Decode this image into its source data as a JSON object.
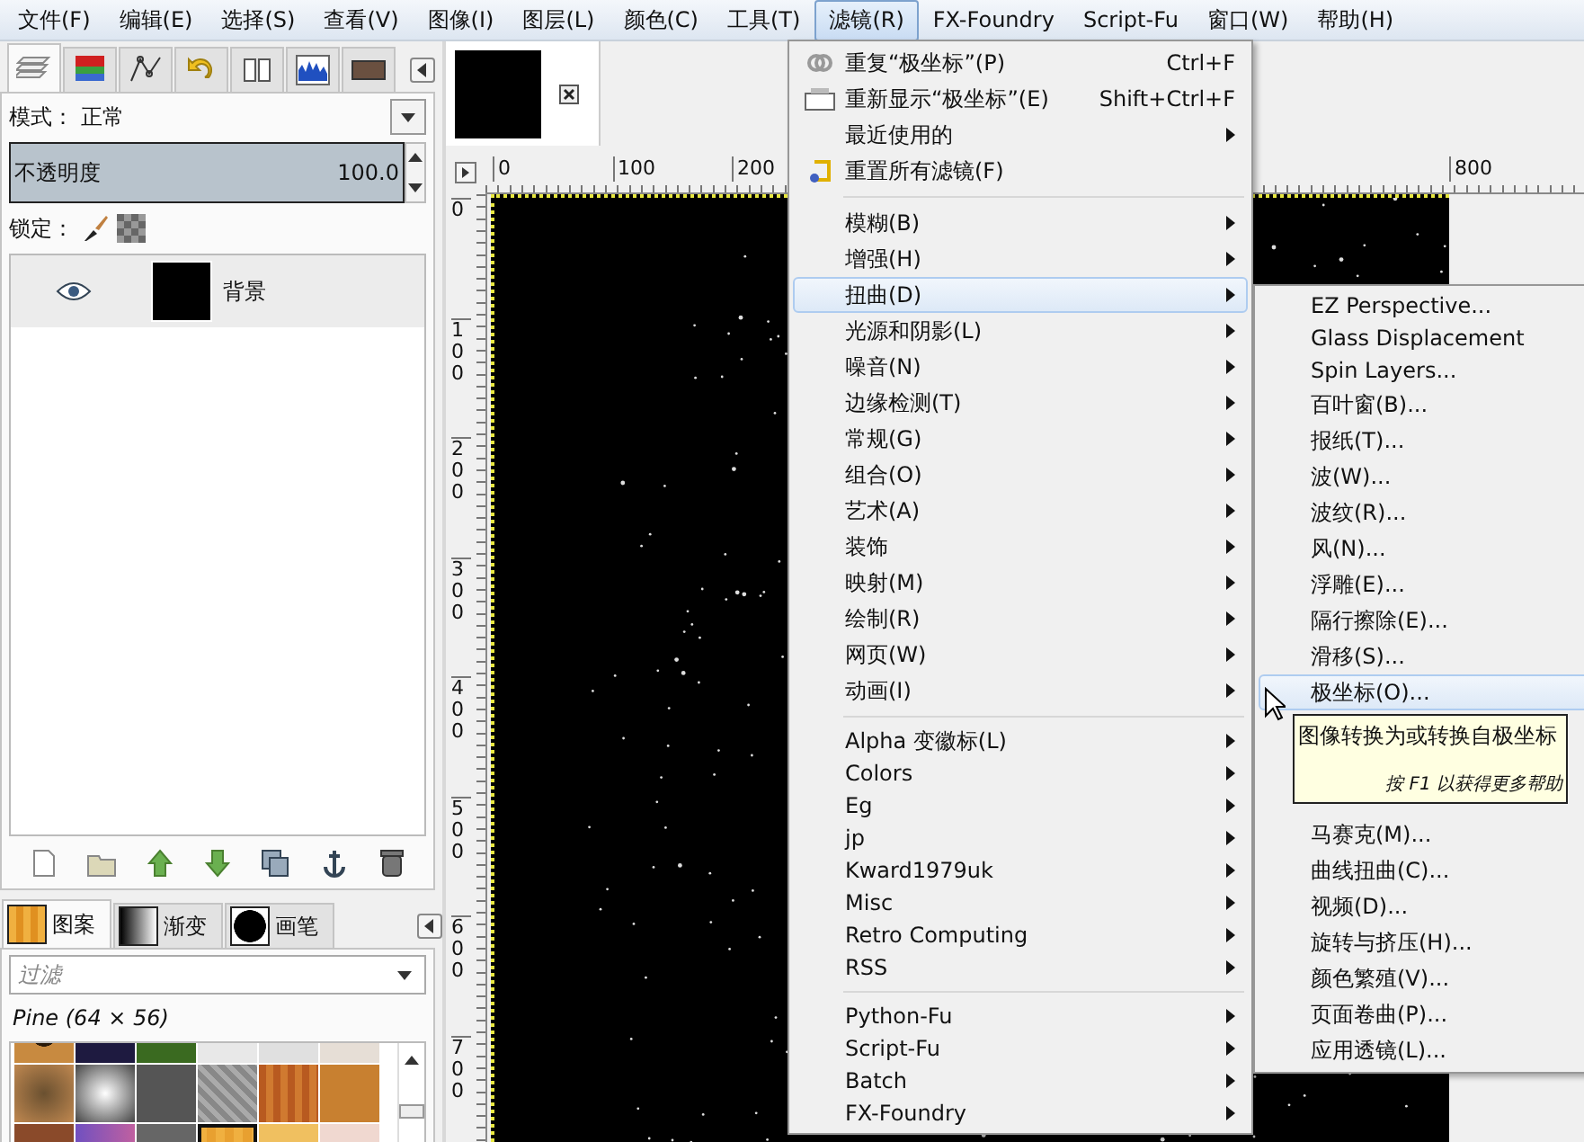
{
  "menubar": [
    {
      "label": "文件(F)",
      "selected": false
    },
    {
      "label": "编辑(E)",
      "selected": false
    },
    {
      "label": "选择(S)",
      "selected": false
    },
    {
      "label": "查看(V)",
      "selected": false
    },
    {
      "label": "图像(I)",
      "selected": false
    },
    {
      "label": "图层(L)",
      "selected": false
    },
    {
      "label": "颜色(C)",
      "selected": false
    },
    {
      "label": "工具(T)",
      "selected": false
    },
    {
      "label": "滤镜(R)",
      "selected": true
    },
    {
      "label": "FX-Foundry",
      "selected": false
    },
    {
      "label": "Script-Fu",
      "selected": false
    },
    {
      "label": "窗口(W)",
      "selected": false
    },
    {
      "label": "帮助(H)",
      "selected": false
    }
  ],
  "left_panel": {
    "dock_tabs": [
      {
        "selected": true
      },
      {
        "selected": false
      },
      {
        "selected": false
      },
      {
        "selected": false
      },
      {
        "selected": false
      },
      {
        "selected": false
      },
      {
        "selected": false
      }
    ],
    "mode": {
      "label": "模式：",
      "value": "正常"
    },
    "opacity": {
      "label": "不透明度",
      "reading": "100.0",
      "level": 1
    },
    "lock": {
      "label": "锁定："
    },
    "layers": [
      {
        "name": "背景",
        "visible": true
      }
    ],
    "resource_tabs": [
      {
        "label": "图案",
        "selected": true
      },
      {
        "label": "渐变",
        "selected": false
      },
      {
        "label": "画笔",
        "selected": false
      }
    ],
    "filter": {
      "placeholder": "过滤"
    },
    "pattern_name": "Pine (64 × 56)",
    "patterns": [
      {
        "selected": false
      },
      {
        "selected": false
      },
      {
        "selected": false
      },
      {
        "selected": false
      },
      {
        "selected": false
      },
      {
        "selected": false
      },
      {
        "selected": false
      },
      {
        "selected": false
      },
      {
        "selected": false
      },
      {
        "selected": false
      },
      {
        "selected": false
      },
      {
        "selected": false
      },
      {
        "selected": false
      },
      {
        "selected": false
      },
      {
        "selected": false
      },
      {
        "selected": true
      },
      {
        "selected": false
      },
      {
        "selected": false
      }
    ]
  },
  "canvas": {
    "h_ruler": [
      "0",
      "100",
      "200",
      "800"
    ],
    "v_ruler": [
      "0",
      "100",
      "200",
      "300",
      "400",
      "500",
      "600",
      "700"
    ]
  },
  "filters_menu": {
    "sections": [
      {
        "items": [
          {
            "label": "重复“极坐标”(P)",
            "shortcut": "Ctrl+F",
            "submenu": false,
            "selected": false
          },
          {
            "label": "重新显示“极坐标”(E)",
            "shortcut": "Shift+Ctrl+F",
            "submenu": false,
            "selected": false
          },
          {
            "label": "最近使用的",
            "submenu": true,
            "selected": false
          },
          {
            "label": "重置所有滤镜(F)",
            "submenu": false,
            "selected": false
          }
        ]
      },
      {
        "items": [
          {
            "label": "模糊(B)",
            "submenu": true,
            "selected": false
          },
          {
            "label": "增强(H)",
            "submenu": true,
            "selected": false
          },
          {
            "label": "扭曲(D)",
            "submenu": true,
            "selected": true
          },
          {
            "label": "光源和阴影(L)",
            "submenu": true,
            "selected": false
          },
          {
            "label": "噪音(N)",
            "submenu": true,
            "selected": false
          },
          {
            "label": "边缘检测(T)",
            "submenu": true,
            "selected": false
          },
          {
            "label": "常规(G)",
            "submenu": true,
            "selected": false
          },
          {
            "label": "组合(O)",
            "submenu": true,
            "selected": false
          },
          {
            "label": "艺术(A)",
            "submenu": true,
            "selected": false
          },
          {
            "label": "装饰",
            "submenu": true,
            "selected": false
          },
          {
            "label": "映射(M)",
            "submenu": true,
            "selected": false
          },
          {
            "label": "绘制(R)",
            "submenu": true,
            "selected": false
          },
          {
            "label": "网页(W)",
            "submenu": true,
            "selected": false
          },
          {
            "label": "动画(I)",
            "submenu": true,
            "selected": false
          }
        ]
      },
      {
        "items": [
          {
            "label": "Alpha 变徽标(L)",
            "submenu": true,
            "selected": false
          },
          {
            "label": "Colors",
            "submenu": true,
            "selected": false
          },
          {
            "label": "Eg",
            "submenu": true,
            "selected": false
          },
          {
            "label": "jp",
            "submenu": true,
            "selected": false
          },
          {
            "label": "Kward1979uk",
            "submenu": true,
            "selected": false
          },
          {
            "label": "Misc",
            "submenu": true,
            "selected": false
          },
          {
            "label": "Retro Computing",
            "submenu": true,
            "selected": false
          },
          {
            "label": "RSS",
            "submenu": true,
            "selected": false
          }
        ]
      },
      {
        "items": [
          {
            "label": "Python-Fu",
            "submenu": true,
            "selected": false
          },
          {
            "label": "Script-Fu",
            "submenu": true,
            "selected": false
          },
          {
            "label": "Batch",
            "submenu": true,
            "selected": false
          },
          {
            "label": "FX-Foundry",
            "submenu": true,
            "selected": false
          }
        ]
      }
    ]
  },
  "distort_submenu": {
    "items": [
      {
        "label": "EZ Perspective...",
        "selected": false
      },
      {
        "label": "Glass Displacement",
        "selected": false
      },
      {
        "label": "Spin Layers...",
        "selected": false
      },
      {
        "label": "百叶窗(B)...",
        "selected": false
      },
      {
        "label": "报纸(T)...",
        "selected": false
      },
      {
        "label": "波(W)...",
        "selected": false
      },
      {
        "label": "波纹(R)...",
        "selected": false
      },
      {
        "label": "风(N)...",
        "selected": false
      },
      {
        "label": "浮雕(E)...",
        "selected": false
      },
      {
        "label": "隔行擦除(E)...",
        "selected": false
      },
      {
        "label": "滑移(S)...",
        "selected": false
      },
      {
        "label": "极坐标(O)...",
        "selected": true
      },
      {
        "label": "马赛克(M)...",
        "selected": false
      },
      {
        "label": "曲线扭曲(C)...",
        "selected": false
      },
      {
        "label": "视频(D)...",
        "selected": false
      },
      {
        "label": "旋转与挤压(H)...",
        "selected": false
      },
      {
        "label": "颜色繁殖(V)...",
        "selected": false
      },
      {
        "label": "页面卷曲(P)...",
        "selected": false
      },
      {
        "label": "应用透镜(L)...",
        "selected": false
      }
    ],
    "tooltip": {
      "text": "图像转换为或转换自极坐标",
      "hint": "按 F1 以获得更多帮助"
    }
  }
}
